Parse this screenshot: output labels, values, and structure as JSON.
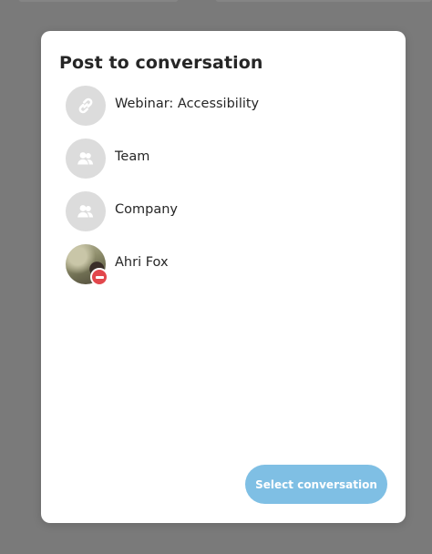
{
  "colors": {
    "overlay": "#7a7a7a",
    "modal_bg": "#ffffff",
    "avatar_bg": "#dcdcdc",
    "button_bg": "#7fbfe4",
    "button_text": "#ffffff",
    "status_badge": "#e2474c",
    "text": "#262626"
  },
  "modal": {
    "title": "Post to conversation",
    "items": [
      {
        "label": "Webinar: Accessibility",
        "icon": "link-icon"
      },
      {
        "label": "Team",
        "icon": "group-icon"
      },
      {
        "label": "Company",
        "icon": "group-icon"
      },
      {
        "label": "Ahri Fox",
        "icon": "user-photo",
        "status": "do-not-disturb-icon"
      }
    ],
    "submit_label": "Select conversation"
  }
}
